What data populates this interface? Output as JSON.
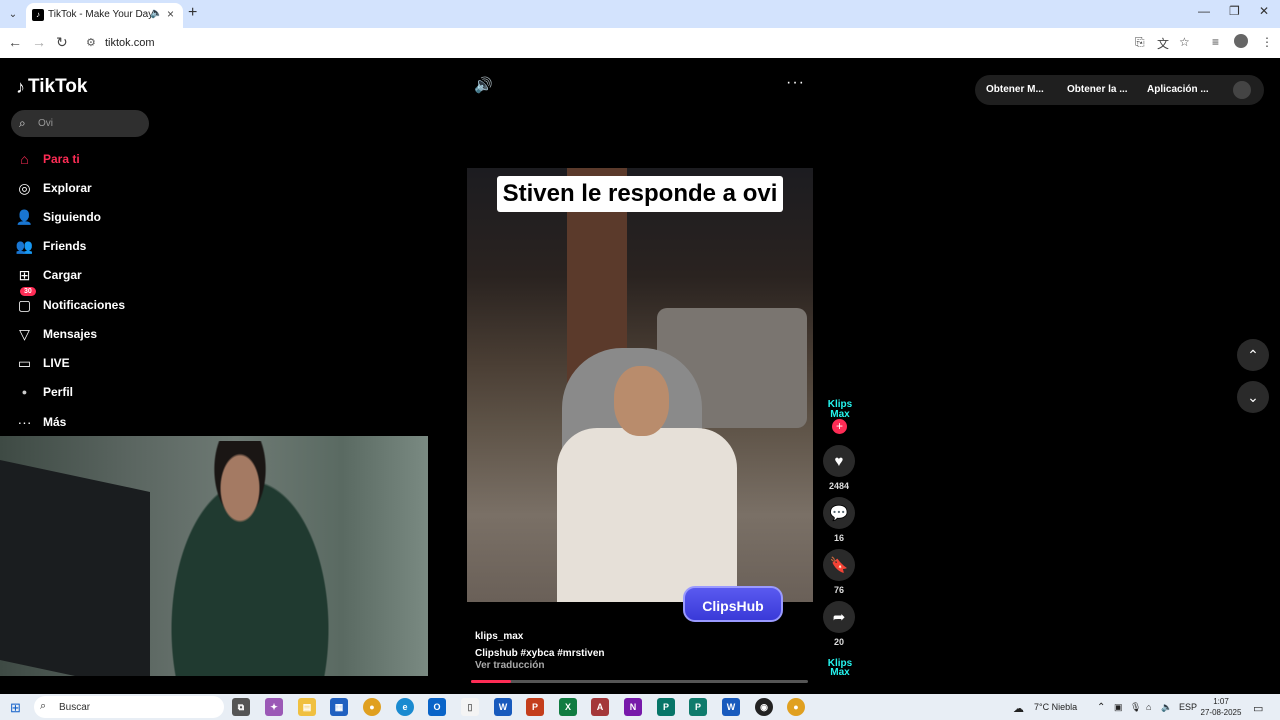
{
  "browser": {
    "tab_title": "TikTok - Make Your Day",
    "url": "tiktok.com"
  },
  "tiktok": {
    "logo_text": "TikTok",
    "search": {
      "value": "Ovi"
    },
    "nav": [
      {
        "label": "Para ti",
        "icon": "home-icon"
      },
      {
        "label": "Explorar",
        "icon": "compass-icon"
      },
      {
        "label": "Siguiendo",
        "icon": "user-follow-icon"
      },
      {
        "label": "Friends",
        "icon": "friends-icon"
      },
      {
        "label": "Cargar",
        "icon": "upload-icon"
      },
      {
        "label": "Notificaciones",
        "icon": "inbox-icon",
        "badge": "30"
      },
      {
        "label": "Mensajes",
        "icon": "send-icon"
      },
      {
        "label": "LIVE",
        "icon": "live-icon"
      },
      {
        "label": "Perfil",
        "icon": "profile-avatar"
      },
      {
        "label": "Más",
        "icon": "more-icon"
      }
    ],
    "top_right": {
      "coins": "Obtener M...",
      "app": "Obtener la ...",
      "download": "Aplicación ..."
    },
    "video": {
      "caption": "Stiven le responde a ovi",
      "watermark": "ClipsHub",
      "author": "klips_max",
      "description": "Clipshub #xybca  #mrstiven",
      "translate": "Ver traducción",
      "progress": 0.12
    },
    "actions": {
      "creator_badge": "Klips Max",
      "likes": "2484",
      "comments": "16",
      "saves": "76",
      "shares": "20"
    }
  },
  "taskbar": {
    "search_label": "Buscar",
    "weather": "7°C  Niebla",
    "language": "ESP",
    "time": "1:07",
    "date": "27-08-2025"
  }
}
